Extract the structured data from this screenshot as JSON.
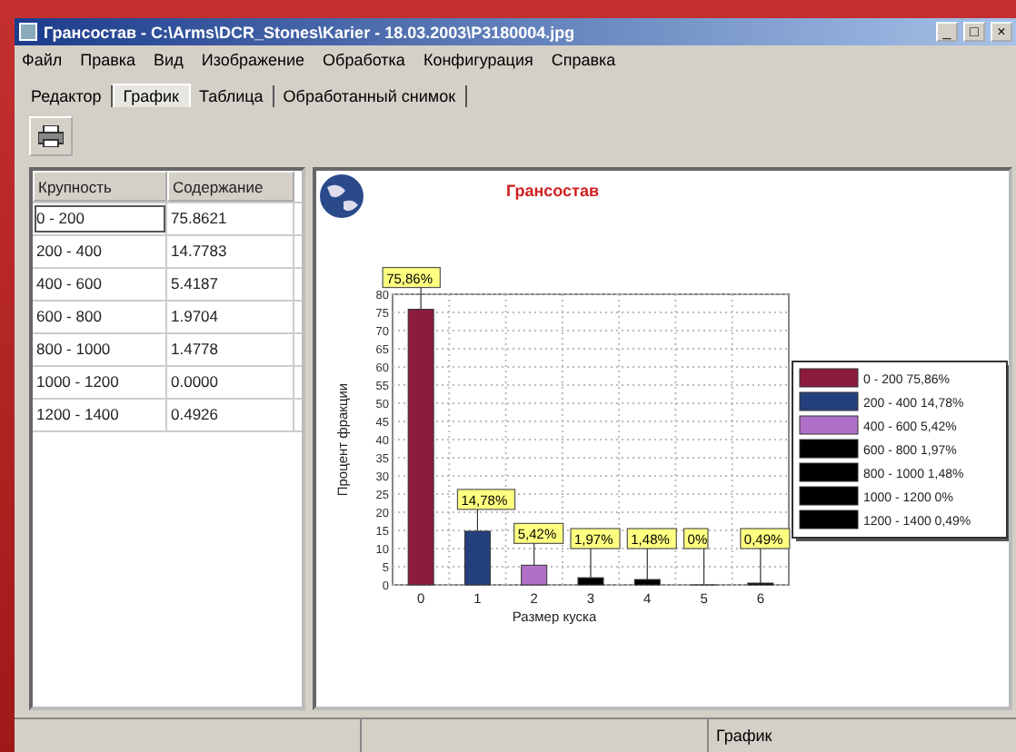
{
  "window": {
    "title": "Грансостав - C:\\Arms\\DCR_Stones\\Karier - 18.03.2003\\P3180004.jpg",
    "controls": [
      "_",
      "□",
      "×"
    ]
  },
  "menu": [
    "Файл",
    "Правка",
    "Вид",
    "Изображение",
    "Обработка",
    "Конфигурация",
    "Справка"
  ],
  "tabs": [
    {
      "label": "Редактор",
      "selected": false
    },
    {
      "label": "График",
      "selected": true
    },
    {
      "label": "Таблица",
      "selected": false
    },
    {
      "label": "Обработанный снимок",
      "selected": false
    }
  ],
  "table": {
    "columns": [
      "Крупность",
      "Содержание"
    ],
    "rows": [
      {
        "cells": [
          "0 - 200",
          "75.8621"
        ],
        "selected": true
      },
      {
        "cells": [
          "200 - 400",
          "14.7783"
        ],
        "selected": false
      },
      {
        "cells": [
          "400 - 600",
          "5.4187"
        ],
        "selected": false
      },
      {
        "cells": [
          "600 - 800",
          "1.9704"
        ],
        "selected": false
      },
      {
        "cells": [
          "800 - 1000",
          "1.4778"
        ],
        "selected": false
      },
      {
        "cells": [
          "1000 - 1200",
          "0.0000"
        ],
        "selected": false
      },
      {
        "cells": [
          "1200 - 1400",
          "0.4926"
        ],
        "selected": false
      }
    ]
  },
  "chart": {
    "title": "Грансостав",
    "legend": [
      {
        "label": "0 - 200 75,86%",
        "color": "#8c1c3c"
      },
      {
        "label": "200 - 400 14,78%",
        "color": "#24407c"
      },
      {
        "label": "400 - 600 5,42%",
        "color": "#b070c8"
      },
      {
        "label": "600 - 800 1,97%",
        "color": "#000000"
      },
      {
        "label": "800 - 1000 1,48%",
        "color": "#000000"
      },
      {
        "label": "1000 - 1200 0%",
        "color": "#000000"
      },
      {
        "label": "1200 - 1400 0,49%",
        "color": "#000000"
      }
    ],
    "chart_data": {
      "type": "bar",
      "xlabel": "Размер куска",
      "ylabel": "Процент фракции",
      "categories": [
        "0",
        "1",
        "2",
        "3",
        "4",
        "5",
        "6"
      ],
      "series": [
        {
          "values": [
            75.86,
            14.78,
            5.42,
            1.97,
            1.48,
            0,
            0.49
          ]
        }
      ],
      "ylim": [
        0,
        80
      ],
      "yticks": [
        0,
        5,
        10,
        15,
        20,
        25,
        30,
        35,
        40,
        45,
        50,
        55,
        60,
        65,
        70,
        75,
        80
      ],
      "grid": true,
      "value_labels": [
        "75,86%",
        "14,78%",
        "5,42%",
        "1,97%",
        "1,48%",
        "0%",
        "0,49%"
      ]
    }
  },
  "status_bar": {
    "text": "График"
  }
}
